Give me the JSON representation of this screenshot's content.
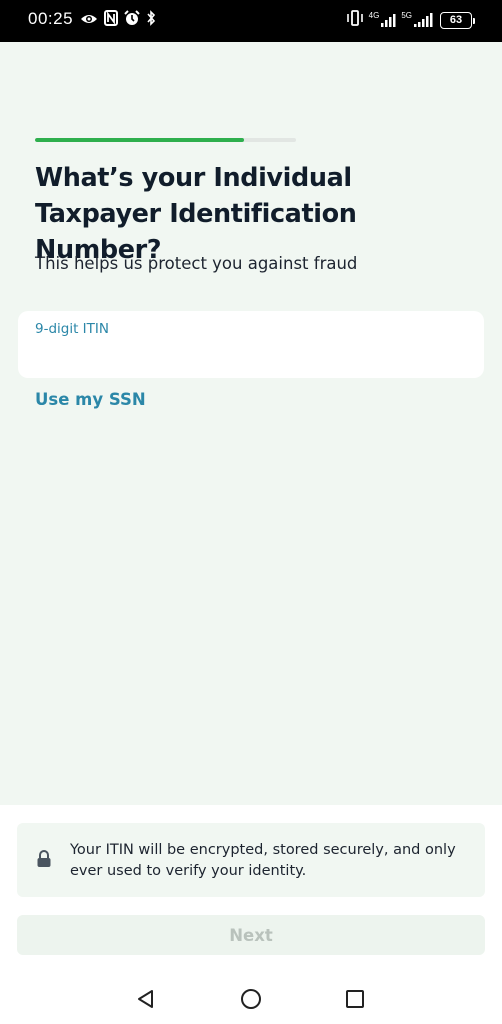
{
  "status_bar": {
    "time": "00:25",
    "left_icons": [
      "eye-icon",
      "nfc-icon",
      "alarm-icon",
      "bluetooth-icon"
    ],
    "right_icons": [
      "vibrate-icon",
      "signal-4g-icon",
      "signal-5g-icon"
    ],
    "network_4g": "4G",
    "network_5g": "5G",
    "battery": "63"
  },
  "progress": {
    "fraction": 0.8,
    "color": "#2eaf4d"
  },
  "header": {
    "title": "What’s your Individual Taxpayer Identification Number?",
    "subtitle": "This helps us protect you against fraud"
  },
  "itin_field": {
    "label": "9-digit ITIN",
    "value": "",
    "placeholder": ""
  },
  "ssn_link": "Use my SSN",
  "notice": {
    "icon": "lock-icon",
    "text": "Your ITIN will be encrypted, stored securely, and only ever used to verify your identity."
  },
  "next_button": "Next",
  "nav": [
    "back-icon",
    "home-icon",
    "recents-icon"
  ],
  "colors": {
    "accent": "#2b87a8",
    "background": "#f1f7f2",
    "title": "#111d2b",
    "button_disabled_bg": "#edf4ee",
    "button_disabled_text": "#b9c2bc"
  }
}
